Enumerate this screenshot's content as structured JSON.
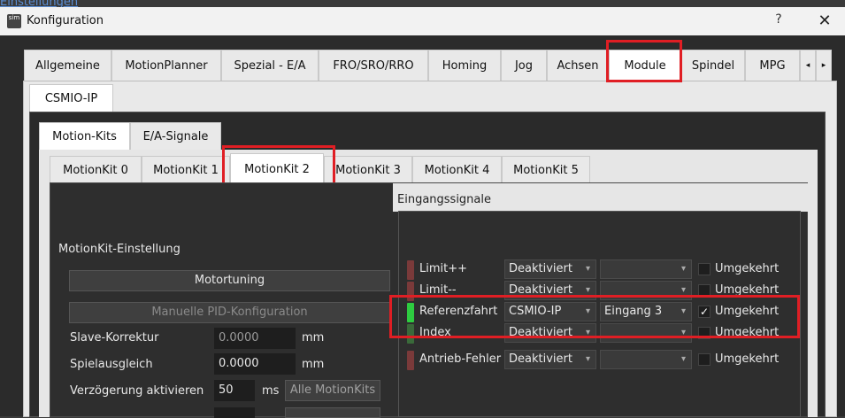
{
  "background_link": "Einstellungen",
  "window": {
    "title": "Konfiguration",
    "help": "?",
    "close": "✕",
    "app_icon_text": "sim"
  },
  "main_tabs": [
    "Allgemeine",
    "MotionPlanner",
    "Spezial - E/A",
    "FRO/SRO/RRO",
    "Homing",
    "Jog",
    "Achsen",
    "Module",
    "Spindel",
    "MPG"
  ],
  "main_tabs_active": "Module",
  "tab_scroll": [
    "◂",
    "▸"
  ],
  "module_tab": "CSMIO-IP",
  "sub_tabs": [
    "Motion-Kits",
    "E/A-Signale"
  ],
  "kit_tabs": [
    "MotionKit 0",
    "MotionKit 1",
    "MotionKit 2",
    "MotionKit 3",
    "MotionKit 4",
    "MotionKit 5"
  ],
  "kit_tabs_active": "MotionKit 2",
  "left_panel": {
    "heading": "MotionKit-Einstellung",
    "motor_btn": "Motortuning",
    "pid_btn": "Manuelle PID-Konfiguration",
    "slave_label": "Slave-Korrektur",
    "slave_value": "0.0000",
    "slave_unit": "mm",
    "backlash_label": "Spielausgleich",
    "backlash_value": "0.0000",
    "backlash_unit": "mm",
    "delay_label": "Verzögerung aktivieren",
    "delay_value": "50",
    "delay_unit": "ms",
    "all_kits_btn": "Alle MotionKits"
  },
  "signals": {
    "heading": "Eingangssignale",
    "rows": [
      {
        "name": "Limit++",
        "source": "Deaktiviert",
        "input": "",
        "invert_label": "Umgekehrt",
        "checked": false,
        "led": "#7a3a3a"
      },
      {
        "name": "Limit--",
        "source": "Deaktiviert",
        "input": "",
        "invert_label": "Umgekehrt",
        "checked": false,
        "led": "#7a3a3a"
      },
      {
        "name": "Referenzfahrt",
        "source": "CSMIO-IP",
        "input": "Eingang 3",
        "invert_label": "Umgekehrt",
        "checked": true,
        "led": "#2ecc40"
      },
      {
        "name": "Index",
        "source": "Deaktiviert",
        "input": "",
        "invert_label": "Umgekehrt",
        "checked": false,
        "led": "#3a6a3a"
      },
      {
        "name": "Antrieb-Fehler",
        "source": "Deaktiviert",
        "input": "",
        "invert_label": "Umgekehrt",
        "checked": false,
        "led": "#7a3a3a"
      }
    ],
    "check_mark": "✓",
    "dropdown_arrow": "▾"
  },
  "colors": {
    "highlight": "#e01e24",
    "led_active": "#2ecc40",
    "led_inactive": "#7a3a3a"
  }
}
